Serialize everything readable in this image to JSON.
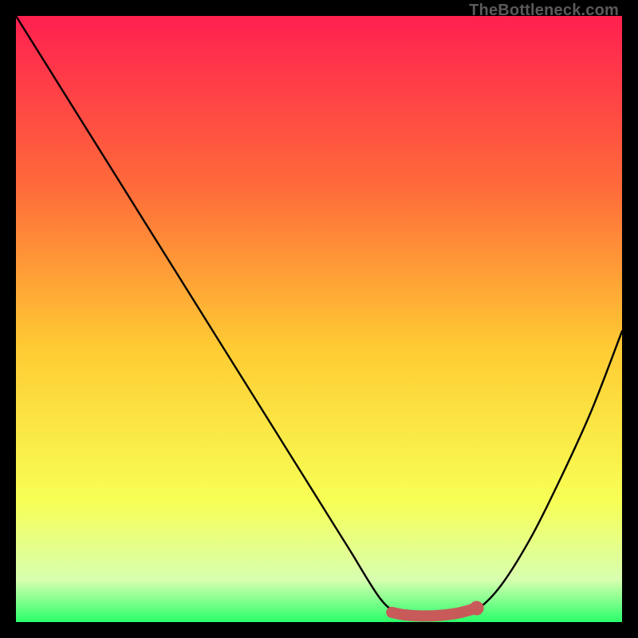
{
  "watermark": "TheBottleneck.com",
  "colors": {
    "background": "#000000",
    "gradient_top": "#ff2050",
    "gradient_mid_upper": "#ff6a3a",
    "gradient_mid": "#ffcc33",
    "gradient_lower": "#f7ff55",
    "gradient_bottom_fade": "#d8ffb0",
    "gradient_bottom": "#2aff6a",
    "curve_stroke": "#000000",
    "marker_fill": "#c85a5a"
  },
  "chart_data": {
    "type": "line",
    "title": "",
    "xlabel": "",
    "ylabel": "",
    "xlim": [
      0,
      100
    ],
    "ylim": [
      0,
      100
    ],
    "series": [
      {
        "name": "bottleneck-curve",
        "x": [
          0,
          5,
          10,
          15,
          20,
          25,
          30,
          35,
          40,
          45,
          50,
          55,
          60,
          63,
          66,
          70,
          73,
          76,
          80,
          85,
          90,
          95,
          100
        ],
        "values": [
          100,
          92,
          84,
          76,
          68,
          60,
          52,
          44,
          36,
          28,
          20,
          12,
          4,
          1.5,
          1,
          1,
          1.2,
          2,
          6,
          14,
          24,
          35,
          48
        ]
      }
    ],
    "markers": [
      {
        "name": "flat-zone-start",
        "x": 62,
        "y": 1.6
      },
      {
        "name": "flat-zone-a",
        "x": 64,
        "y": 1.2
      },
      {
        "name": "flat-zone-b",
        "x": 67,
        "y": 1.0
      },
      {
        "name": "flat-zone-c",
        "x": 70,
        "y": 1.1
      },
      {
        "name": "flat-zone-d",
        "x": 73,
        "y": 1.5
      },
      {
        "name": "flat-zone-end",
        "x": 76,
        "y": 2.3
      }
    ]
  }
}
